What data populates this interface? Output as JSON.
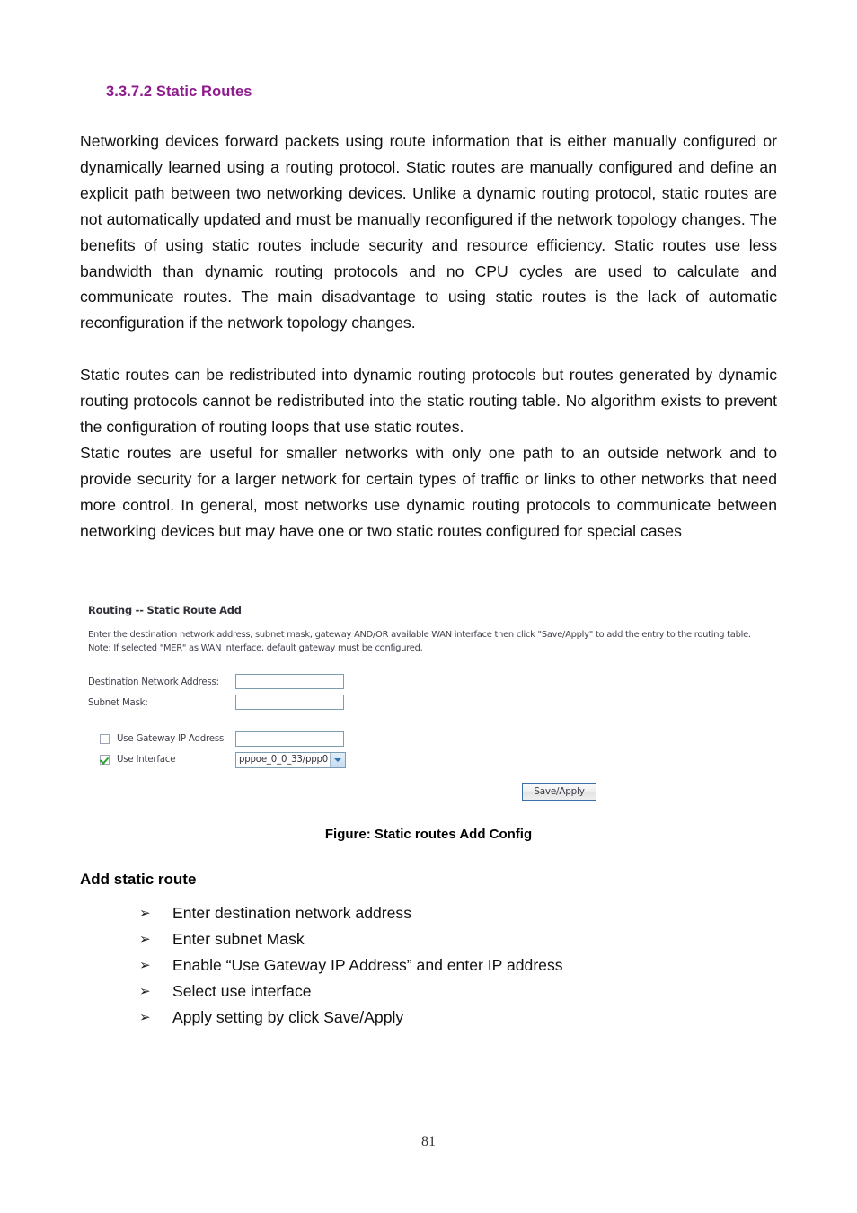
{
  "document": {
    "section_heading": "3.3.7.2 Static Routes",
    "heading_color": "#8e1a8e",
    "page_number": "81"
  },
  "paragraphs": {
    "p1": "Networking devices forward packets using route information that is either manually configured or dynamically learned using a routing protocol. Static routes are manually configured and define an explicit path between two networking devices. Unlike a dynamic routing protocol, static routes are not automatically updated and must be manually reconfigured if the network topology changes. The benefits of using static routes include security and resource efficiency. Static routes use less bandwidth than dynamic routing protocols and no CPU cycles are used to calculate and communicate routes. The main disadvantage to using static routes is the lack of automatic reconfiguration if the network topology changes.",
    "p2": "Static routes can be redistributed into dynamic routing protocols but routes generated by dynamic routing protocols cannot be redistributed into the static routing table. No algorithm exists to prevent the configuration of routing loops that use static routes.",
    "p3": "Static routes are useful for smaller networks with only one path to an outside network and to provide security for a larger network for certain types of traffic or links to other networks that need more control. In general, most networks use dynamic routing protocols to communicate between networking devices but may have one or two static routes configured for special cases"
  },
  "router_screenshot": {
    "title": "Routing -- Static Route Add",
    "description_line_1": "Enter the destination network address, subnet mask, gateway AND/OR available WAN interface then click \"Save/Apply\" to add the entry to the routing table.",
    "description_line_2": "Note: If selected \"MER\" as WAN interface, default gateway must be configured.",
    "fields": [
      {
        "label": "Destination Network Address:",
        "value": ""
      },
      {
        "label": "Subnet Mask:",
        "value": ""
      }
    ],
    "gateway_option": {
      "label": "Use Gateway IP Address",
      "checked": false,
      "value": ""
    },
    "interface_option": {
      "label": "Use Interface",
      "checked": true,
      "selected": "pppoe_0_0_33/ppp0",
      "arrow_icon": "chevron-down-icon"
    },
    "save_button": "Save/Apply",
    "border_color": "#7c9cb2",
    "check_color": "#2aa32a"
  },
  "figure": {
    "caption": "Figure: Static routes Add Config"
  },
  "instructions": {
    "heading": "Add static route",
    "bullet_glyph": "➢",
    "steps": [
      "Enter destination network address",
      "Enter subnet Mask",
      "Enable “Use Gateway IP Address” and enter IP address",
      "Select use interface",
      "Apply setting by click Save/Apply"
    ]
  }
}
